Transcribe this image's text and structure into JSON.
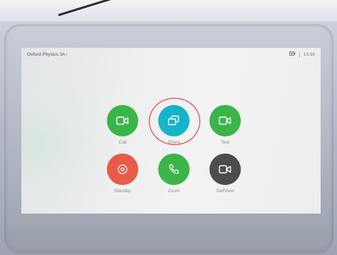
{
  "status_bar": {
    "room_title": "Oxford Physics 3A ›",
    "time": "13:56",
    "icon": "camera-display-icon"
  },
  "buttons": [
    {
      "id": "call",
      "label": "Call",
      "icon": "video-camera-icon",
      "color": "#3bb54a"
    },
    {
      "id": "share",
      "label": "Share",
      "icon": "share-screens-icon",
      "color": "#16b4c8"
    },
    {
      "id": "test",
      "label": "Test",
      "icon": "video-camera-icon",
      "color": "#3bb54a"
    },
    {
      "id": "standby",
      "label": "Standby",
      "icon": "standby-icon",
      "color": "#e95a48"
    },
    {
      "id": "zoom",
      "label": "Zoom",
      "icon": "phone-icon",
      "color": "#3bb54a"
    },
    {
      "id": "selfview",
      "label": "SelfView",
      "icon": "video-camera-icon",
      "color": "#4c4c4c"
    }
  ],
  "highlight": {
    "target": "share",
    "color": "#e3262b"
  }
}
